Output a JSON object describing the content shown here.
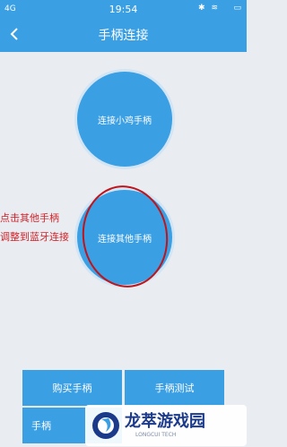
{
  "status_bar": {
    "signal": "4G",
    "time": "19:54",
    "right_icons": "✱ ≋",
    "battery": "▭"
  },
  "header": {
    "title": "手柄连接"
  },
  "circles": {
    "connect_xiaoji": "连接小鸡手柄",
    "connect_other": "连接其他手柄"
  },
  "annotation": {
    "line1": "点击其他手柄",
    "line2": "调整到蓝牙连接"
  },
  "bottom_buttons": {
    "buy": "购买手柄",
    "test": "手柄测试",
    "third": "手柄"
  },
  "watermark": {
    "title": "龙萃游戏园",
    "subtitle": "LONGCUI TECH"
  },
  "colors": {
    "primary": "#3b9fe3",
    "annotation_red": "#d2232a",
    "background": "#e9edf1"
  }
}
